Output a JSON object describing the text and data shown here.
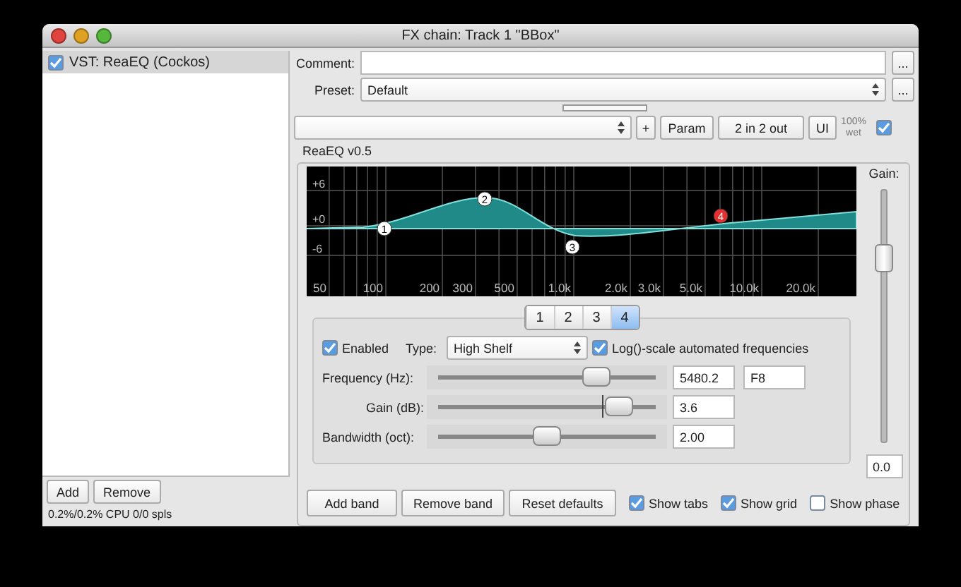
{
  "window": {
    "title": "FX chain: Track 1 \"BBox\""
  },
  "fx_list": {
    "items": [
      {
        "label": "VST: ReaEQ (Cockos)",
        "checked": true,
        "selected": true
      }
    ],
    "buttons": [
      "Add",
      "Remove"
    ],
    "status": "0.2%/0.2% CPU 0/0 spls"
  },
  "comment": {
    "label": "Comment:",
    "button": "..."
  },
  "preset": {
    "label": "Preset:",
    "value": "Default",
    "button": "..."
  },
  "progress": {
    "level": 0
  },
  "toolbar": {
    "buttons": [
      "+",
      "Param",
      "2 in 2 out",
      "UI"
    ],
    "wet_label": "100% wet",
    "wet_checked": true
  },
  "plugin": {
    "title": "ReaEQ v0.5",
    "graph": {
      "y_labels": [
        "+6",
        "+0",
        "-6"
      ],
      "x_labels": [
        "50",
        "100",
        "200",
        "300",
        "500",
        "1.0k",
        "2.0k",
        "3.0k",
        "5.0k",
        "10.0k",
        "20.0k"
      ],
      "nodes": [
        {
          "label": "1",
          "selected": false
        },
        {
          "label": "2",
          "selected": false
        },
        {
          "label": "3",
          "selected": false
        },
        {
          "label": "4",
          "selected": true
        }
      ]
    },
    "gain": {
      "label": "Gain:",
      "level": 0.73,
      "value": "0.0"
    },
    "band_tabs": [
      {
        "label": "1",
        "selected": false
      },
      {
        "label": "2",
        "selected": false
      },
      {
        "label": "3",
        "selected": false
      },
      {
        "label": "4",
        "selected": true
      }
    ],
    "band": {
      "enabled": {
        "label": "Enabled",
        "checked": true
      },
      "type_label": "Type:",
      "type": "High Shelf",
      "log_scale": {
        "label": "Log()-scale automated frequencies",
        "checked": true
      },
      "params": [
        {
          "label": "Frequency (Hz):",
          "level": 0.73,
          "value": "5480.2",
          "note": "F8"
        },
        {
          "label": "Gain (dB):",
          "level": 0.83,
          "value": "3.6"
        },
        {
          "label": "Bandwidth (oct):",
          "level": 0.5,
          "value": "2.00"
        }
      ]
    },
    "buttons": [
      "Add band",
      "Remove band",
      "Reset defaults"
    ],
    "options": [
      {
        "label": "Show tabs",
        "checked": true
      },
      {
        "label": "Show grid",
        "checked": true
      },
      {
        "label": "Show phase",
        "checked": false
      }
    ]
  }
}
